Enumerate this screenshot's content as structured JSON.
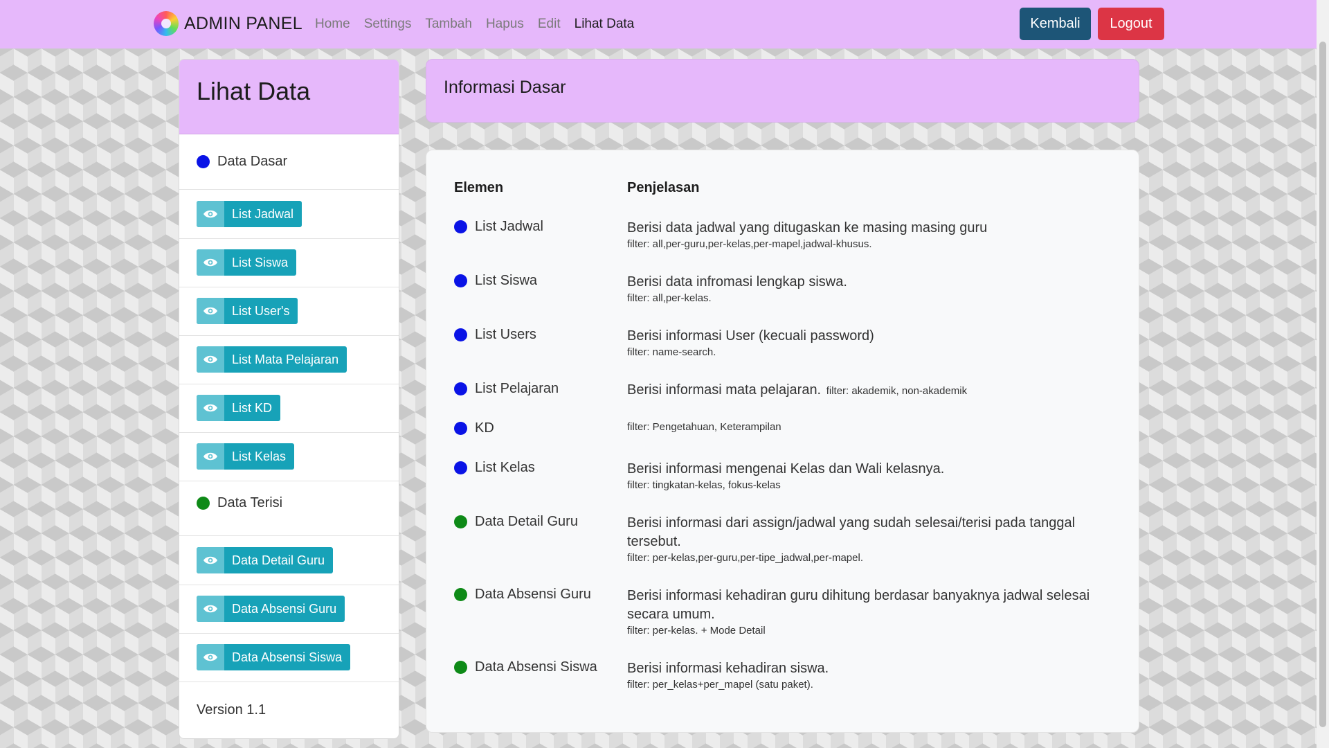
{
  "navbar": {
    "brand": "ADMIN PANEL",
    "links": [
      "Home",
      "Settings",
      "Tambah",
      "Hapus",
      "Edit",
      "Lihat Data"
    ],
    "active_link": "Lihat Data",
    "back_label": "Kembali",
    "logout_label": "Logout"
  },
  "sidebar": {
    "title": "Lihat Data",
    "section1": {
      "label": "Data Dasar",
      "color": "#0a13e6"
    },
    "section1_buttons": [
      "List Jadwal",
      "List Siswa",
      "List User's",
      "List Mata Pelajaran",
      "List KD",
      "List Kelas"
    ],
    "section2": {
      "label": "Data Terisi",
      "color": "#0e8a17"
    },
    "section2_buttons": [
      "Data Detail Guru",
      "Data Absensi Guru",
      "Data Absensi Siswa"
    ],
    "version": "Version 1.1",
    "button_icon": "eye-icon"
  },
  "main": {
    "header_title": "Informasi Dasar",
    "col_element": "Elemen",
    "col_explanation": "Penjelasan",
    "rows": [
      {
        "name": "List Jadwal",
        "color": "blue",
        "desc": "Berisi data jadwal yang ditugaskan ke masing masing guru",
        "filter": "filter: all,per-guru,per-kelas,per-mapel,jadwal-khusus."
      },
      {
        "name": "List Siswa",
        "color": "blue",
        "desc": "Berisi data infromasi lengkap siswa.",
        "filter": "filter: all,per-kelas."
      },
      {
        "name": "List Users",
        "color": "blue",
        "desc": "Berisi informasi User (kecuali password)",
        "filter": "filter: name-search."
      },
      {
        "name": "List Pelajaran",
        "color": "blue",
        "desc": "Berisi informasi mata pelajaran.",
        "filter": "filter: akademik, non-akademik"
      },
      {
        "name": "KD",
        "color": "blue",
        "desc": "",
        "filter": "filter: Pengetahuan, Keterampilan"
      },
      {
        "name": "List Kelas",
        "color": "blue",
        "desc": "Berisi informasi mengenai Kelas dan Wali kelasnya.",
        "filter": "filter: tingkatan-kelas, fokus-kelas"
      },
      {
        "name": "Data Detail Guru",
        "color": "green",
        "desc": "Berisi informasi dari assign/jadwal yang sudah selesai/terisi pada tanggal tersebut.",
        "filter": "filter: per-kelas,per-guru,per-tipe_jadwal,per-mapel."
      },
      {
        "name": "Data Absensi Guru",
        "color": "green",
        "desc": "Berisi informasi kehadiran guru dihitung berdasar banyaknya jadwal selesai secara umum.",
        "filter": "filter: per-kelas. + Mode Detail"
      },
      {
        "name": "Data Absensi Siswa",
        "color": "green",
        "desc": "Berisi informasi kehadiran siswa.",
        "filter": "filter: per_kelas+per_mapel (satu paket)."
      }
    ]
  }
}
